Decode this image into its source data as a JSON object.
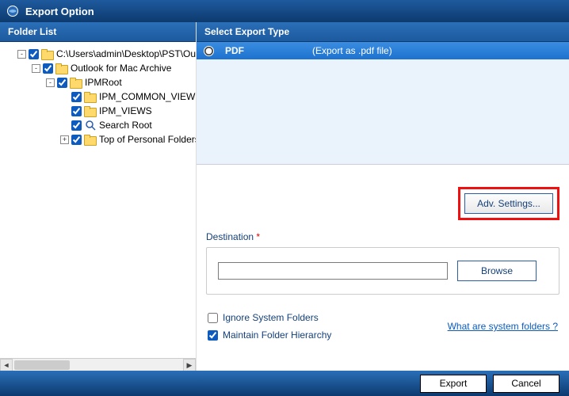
{
  "window": {
    "title": "Export Option"
  },
  "left": {
    "header": "Folder List",
    "tree": [
      {
        "level": 1,
        "expander": "-",
        "checked": true,
        "icon": "folder",
        "label": "C:\\Users\\admin\\Desktop\\PST\\Outl"
      },
      {
        "level": 2,
        "expander": "-",
        "checked": true,
        "icon": "folder",
        "label": "Outlook for Mac Archive"
      },
      {
        "level": 3,
        "expander": "-",
        "checked": true,
        "icon": "folder",
        "label": "IPMRoot"
      },
      {
        "level": 4,
        "expander": "",
        "checked": true,
        "icon": "folder",
        "label": "IPM_COMMON_VIEWS"
      },
      {
        "level": 4,
        "expander": "",
        "checked": true,
        "icon": "folder",
        "label": "IPM_VIEWS"
      },
      {
        "level": 4,
        "expander": "",
        "checked": true,
        "icon": "search",
        "label": "Search Root"
      },
      {
        "level": 4,
        "expander": "+",
        "checked": true,
        "icon": "folder",
        "label": "Top of Personal Folders"
      }
    ]
  },
  "right": {
    "header": "Select Export Type",
    "export_types": [
      {
        "selected": true,
        "name": "PDF",
        "desc": "(Export as .pdf file)"
      }
    ],
    "adv_settings_label": "Adv. Settings...",
    "destination": {
      "label": "Destination",
      "required_mark": "*",
      "value": "",
      "browse_label": "Browse"
    },
    "options": {
      "ignore_system": {
        "checked": false,
        "label": "Ignore System Folders"
      },
      "maintain_hierarchy": {
        "checked": true,
        "label": "Maintain Folder Hierarchy"
      },
      "help_link": "What are system folders ?"
    }
  },
  "footer": {
    "export_label": "Export",
    "cancel_label": "Cancel"
  }
}
